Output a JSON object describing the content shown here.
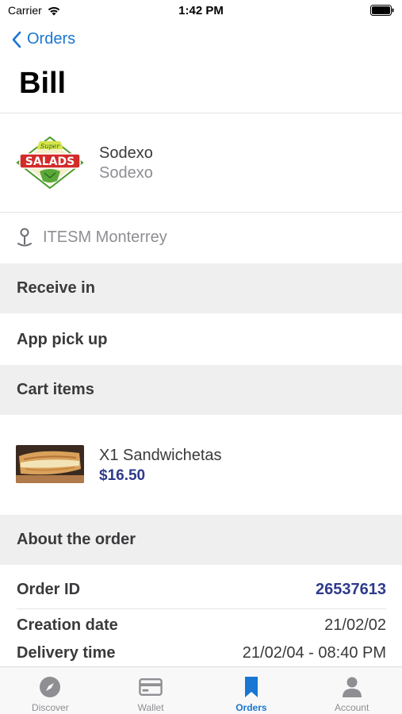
{
  "status_bar": {
    "carrier": "Carrier",
    "time": "1:42 PM"
  },
  "nav": {
    "back_label": "Orders",
    "title": "Bill"
  },
  "vendor": {
    "logo_text_top": "Super",
    "logo_text_main": "SALADS",
    "name": "Sodexo",
    "subtitle": "Sodexo"
  },
  "location": {
    "icon": "map-pin-icon",
    "label": "ITESM Monterrey"
  },
  "sections": {
    "receive_header": "Receive in",
    "receive_value": "App pick up",
    "cart_header": "Cart items",
    "about_header": "About the order"
  },
  "cart_items": [
    {
      "name": "X1 Sandwichetas",
      "price": "$16.50"
    }
  ],
  "order_info": {
    "order_id_label": "Order ID",
    "order_id_value": "26537613",
    "creation_label": "Creation date",
    "creation_value": "21/02/02",
    "delivery_label": "Delivery time",
    "delivery_value": "21/02/04 - 08:40 PM"
  },
  "tabs": [
    {
      "label": "Discover",
      "icon": "compass-icon",
      "active": false
    },
    {
      "label": "Wallet",
      "icon": "card-icon",
      "active": false
    },
    {
      "label": "Orders",
      "icon": "bookmark-icon",
      "active": true
    },
    {
      "label": "Account",
      "icon": "person-icon",
      "active": false
    }
  ],
  "colors": {
    "accent_blue": "#1976d2",
    "price_blue": "#2e3a8c",
    "section_bg": "#efefef"
  }
}
